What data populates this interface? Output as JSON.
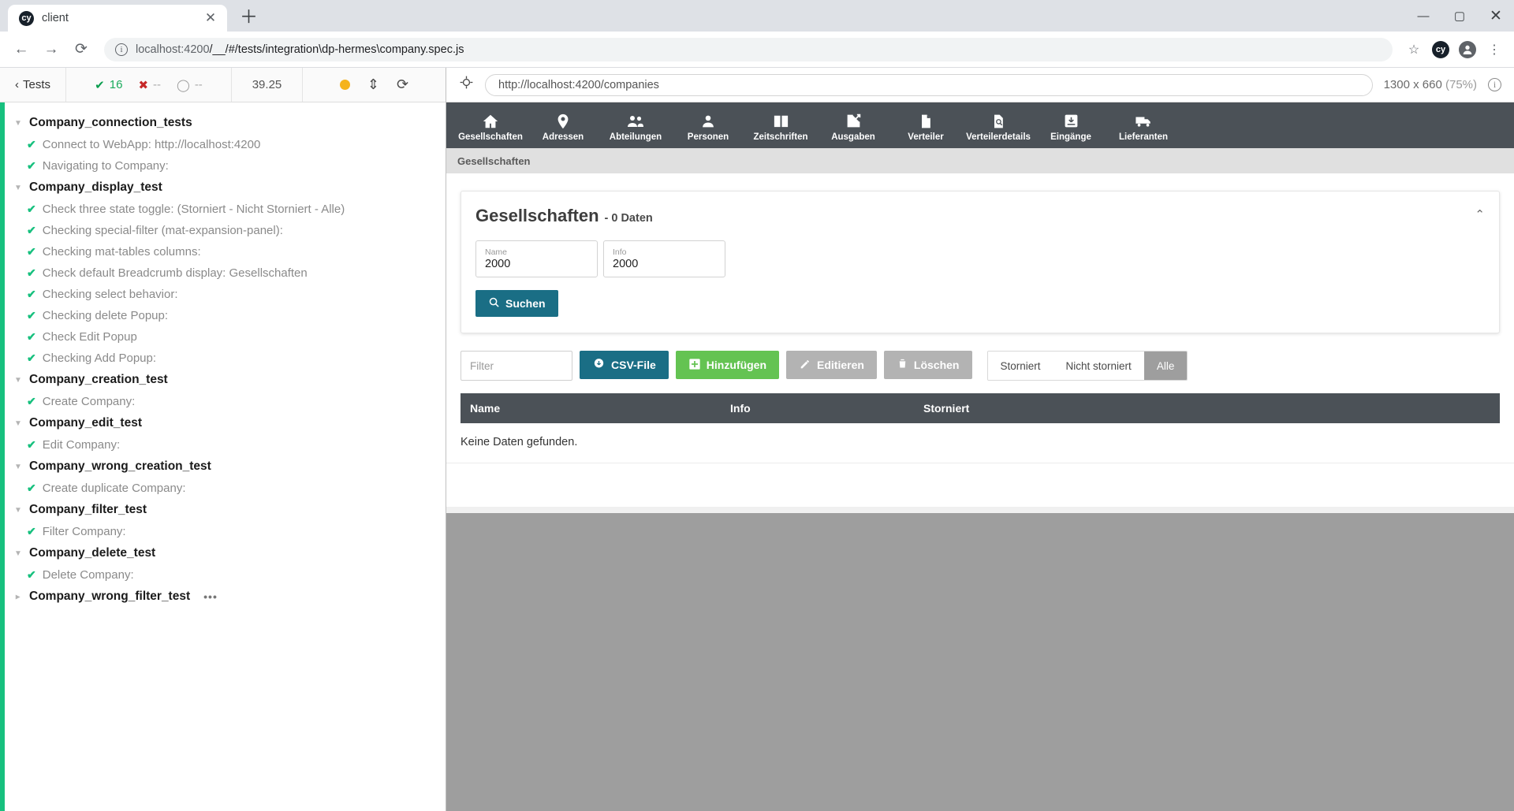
{
  "browser": {
    "tab": {
      "title": "client",
      "favicon_icon": "cypress-logo-icon",
      "close_icon": "✕"
    },
    "newtab_icon": "＋",
    "window_controls": {
      "minimize": "—",
      "maximize": "▢",
      "close": "✕"
    },
    "nav": {
      "back_icon": "←",
      "forward_icon": "→",
      "reload_icon": "⟳"
    },
    "omnibox": {
      "info_icon": "i",
      "url_host": "localhost:4200",
      "url_path": "/__/#/tests/integration\\dp-hermes\\company.spec.js",
      "star_icon": "☆",
      "extension_badge": "cy",
      "profile_icon": "account-circle-icon",
      "menu_icon": "⋮"
    }
  },
  "reporter": {
    "back_label": "Tests",
    "back_icon": "‹",
    "stats": {
      "passed": {
        "icon": "✔",
        "value": "16"
      },
      "failed": {
        "icon": "✖",
        "value": "--"
      },
      "pending": {
        "icon": "◯",
        "value": "--"
      }
    },
    "duration": "39.25",
    "controls": {
      "status_dot_color": "#f5b31b",
      "expand_icon": "⇕",
      "restart_icon": "⟳"
    },
    "suites": [
      {
        "name": "Company_connection_tests",
        "open": true,
        "tests": [
          {
            "title": "Connect to WebApp: http://localhost:4200",
            "state": "passed"
          },
          {
            "title": "Navigating to Company:",
            "state": "passed"
          }
        ]
      },
      {
        "name": "Company_display_test",
        "open": true,
        "tests": [
          {
            "title": "Check three state toggle: (Storniert - Nicht Storniert - Alle)",
            "state": "passed"
          },
          {
            "title": "Checking special-filter (mat-expansion-panel):",
            "state": "passed"
          },
          {
            "title": "Checking mat-tables columns:",
            "state": "passed"
          },
          {
            "title": "Check default Breadcrumb display: Gesellschaften",
            "state": "passed"
          },
          {
            "title": "Checking select behavior:",
            "state": "passed"
          },
          {
            "title": "Checking delete Popup:",
            "state": "passed"
          },
          {
            "title": "Check Edit Popup",
            "state": "passed"
          },
          {
            "title": "Checking Add Popup:",
            "state": "passed"
          }
        ]
      },
      {
        "name": "Company_creation_test",
        "open": true,
        "tests": [
          {
            "title": "Create Company:",
            "state": "passed"
          }
        ]
      },
      {
        "name": "Company_edit_test",
        "open": true,
        "tests": [
          {
            "title": "Edit Company:",
            "state": "passed"
          }
        ]
      },
      {
        "name": "Company_wrong_creation_test",
        "open": true,
        "tests": [
          {
            "title": "Create duplicate Company:",
            "state": "passed"
          }
        ]
      },
      {
        "name": "Company_filter_test",
        "open": true,
        "tests": [
          {
            "title": "Filter Company:",
            "state": "passed"
          }
        ]
      },
      {
        "name": "Company_delete_test",
        "open": true,
        "tests": [
          {
            "title": "Delete Company:",
            "state": "passed"
          }
        ]
      },
      {
        "name": "Company_wrong_filter_test",
        "open": false,
        "trailing": "•••",
        "tests": []
      }
    ]
  },
  "preview": {
    "selector_icon": "crosshair-icon",
    "url": "http://localhost:4200/companies",
    "viewport": "1300 x 660",
    "zoom": "(75%)",
    "info_icon": "i"
  },
  "app": {
    "nav_items": [
      {
        "label": "Gesellschaften",
        "icon": "home-icon"
      },
      {
        "label": "Adressen",
        "icon": "location-pin-icon"
      },
      {
        "label": "Abteilungen",
        "icon": "people-group-icon"
      },
      {
        "label": "Personen",
        "icon": "person-icon"
      },
      {
        "label": "Zeitschriften",
        "icon": "book-icon"
      },
      {
        "label": "Ausgaben",
        "icon": "open-in-new-icon"
      },
      {
        "label": "Verteiler",
        "icon": "document-icon"
      },
      {
        "label": "Verteilerdetails",
        "icon": "document-search-icon"
      },
      {
        "label": "Eingänge",
        "icon": "inbox-download-icon"
      },
      {
        "label": "Lieferanten",
        "icon": "truck-icon"
      }
    ],
    "breadcrumb": "Gesellschaften",
    "search_card": {
      "title": "Gesellschaften",
      "subtitle": "- 0 Daten",
      "collapse_icon": "⌃",
      "fields": [
        {
          "label": "Name",
          "value": "2000"
        },
        {
          "label": "Info",
          "value": "2000"
        }
      ],
      "search_button": {
        "label": "Suchen",
        "icon": "magnifier-icon"
      }
    },
    "toolbar": {
      "filter_placeholder": "Filter",
      "filter_value": "",
      "csv_button": {
        "label": "CSV-File",
        "icon": "cloud-download-icon"
      },
      "add_button": {
        "label": "Hinzufügen",
        "icon": "plus-box-icon"
      },
      "edit_button": {
        "label": "Editieren",
        "icon": "pencil-icon",
        "disabled": true
      },
      "delete_button": {
        "label": "Löschen",
        "icon": "trash-icon",
        "disabled": true
      },
      "toggle": {
        "options": [
          "Storniert",
          "Nicht storniert",
          "Alle"
        ],
        "selected": "Alle"
      }
    },
    "table": {
      "columns": [
        "Name",
        "Info",
        "Storniert"
      ],
      "rows": [],
      "empty_message": "Keine Daten gefunden."
    }
  }
}
